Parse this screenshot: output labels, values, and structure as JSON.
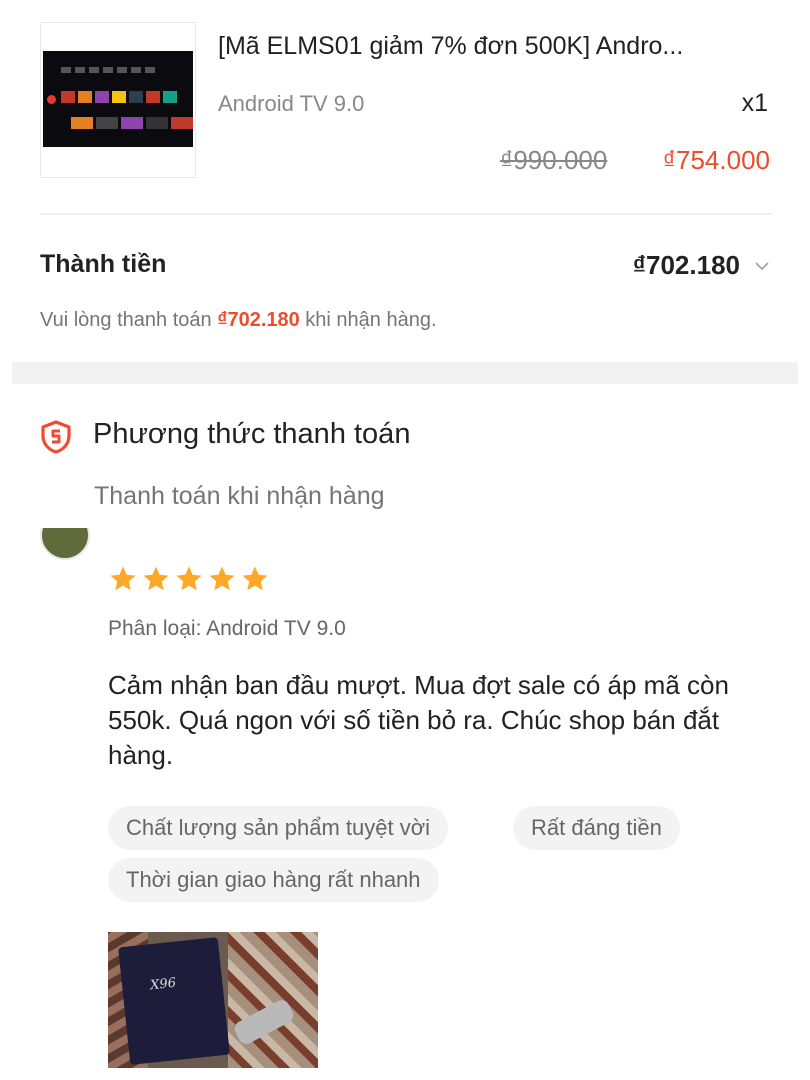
{
  "product": {
    "title": "[Mã ELMS01 giảm 7% đơn 500K] Andro...",
    "variant": "Android TV 9.0",
    "quantity": "x1",
    "original_price": "₫990.000",
    "sale_price": "₫754.000"
  },
  "total": {
    "label": "Thành tiền",
    "value": "₫702.180",
    "note_prefix": "Vui lòng thanh toán ",
    "note_amount": "₫702.180",
    "note_suffix": " khi nhận hàng."
  },
  "payment": {
    "title": "Phương thức thanh toán",
    "method": "Thanh toán khi nhận hàng"
  },
  "review": {
    "rating": 5,
    "classification": "Phân loại: Android TV 9.0",
    "text": "Cảm nhận ban đầu mượt. Mua đợt sale có áp mã còn 550k. Quá ngon với số tiền bỏ ra. Chúc shop bán đắt hàng.",
    "tags": [
      "Chất lượng sản phẩm tuyệt vời",
      "Rất đáng tiền",
      "Thời gian giao hàng rất nhanh"
    ],
    "photo_box_label": "X96"
  },
  "colors": {
    "accent": "#ee4d2d",
    "star": "#ffa726",
    "muted": "#757575"
  },
  "icons": {
    "payment": "shield-icon",
    "expand": "chevron-down-icon",
    "rating": "star-icon"
  }
}
